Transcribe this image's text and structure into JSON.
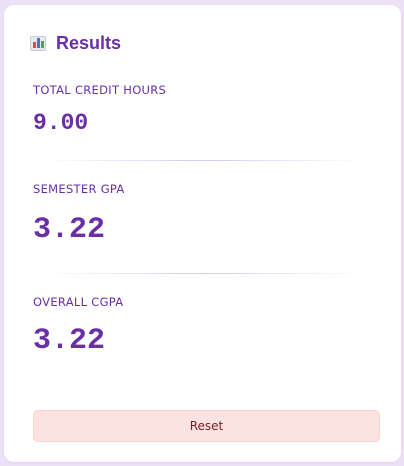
{
  "results": {
    "icon": "bar-chart-icon",
    "title": "Results",
    "total_credit_hours": {
      "label": "TOTAL CREDIT HOURS",
      "value": "9.00"
    },
    "semester_gpa": {
      "label": "SEMESTER GPA",
      "value": "3.22"
    },
    "overall_cgpa": {
      "label": "OVERALL CGPA",
      "value": "3.22"
    },
    "reset_label": "Reset"
  },
  "colors": {
    "accent": "#6a2ea5",
    "reset_bg": "#fde2e2",
    "reset_text": "#7a1f1f",
    "page_bg": "#ece2f7"
  }
}
